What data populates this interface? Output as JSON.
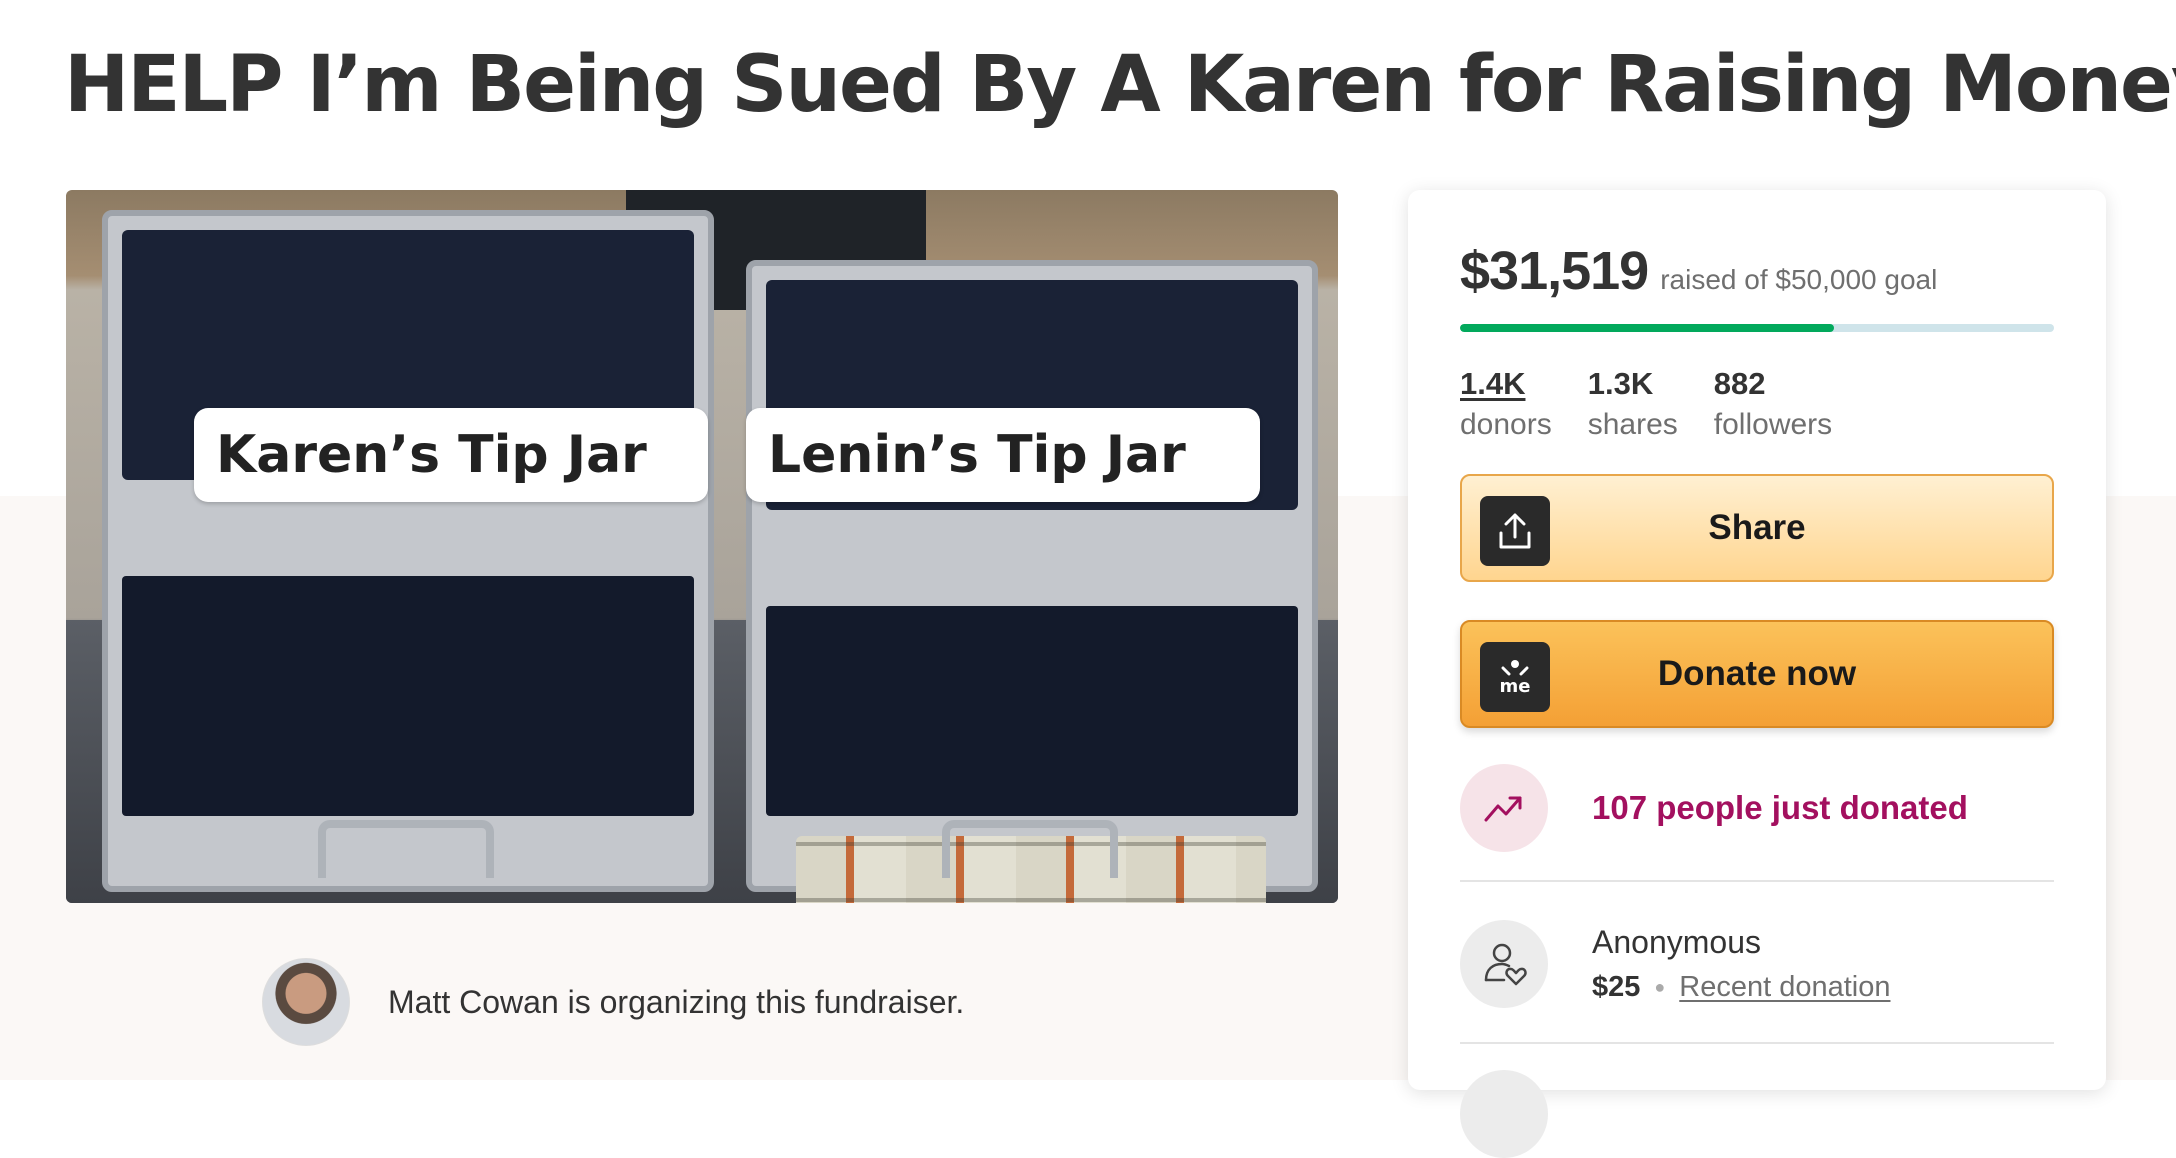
{
  "page": {
    "title": "HELP I’m Being Sued By A Karen for Raising Money"
  },
  "hero": {
    "left_label": "Karen’s Tip Jar",
    "right_label": "Lenin’s Tip Jar"
  },
  "organizer": {
    "text": "Matt Cowan is organizing this fundraiser."
  },
  "sidebar": {
    "raised_amount": "$31,519",
    "goal_text": "raised of $50,000 goal",
    "progress_fraction": 0.63,
    "stats": [
      {
        "value": "1.4K",
        "label": "donors"
      },
      {
        "value": "1.3K",
        "label": "shares"
      },
      {
        "value": "882",
        "label": "followers"
      }
    ],
    "share_label": "Share",
    "donate_label": "Donate now",
    "donate_icon_text": "me",
    "activity_text": "107 people just donated",
    "donation": {
      "name": "Anonymous",
      "amount": "$25",
      "tag": "Recent donation"
    }
  },
  "colors": {
    "progress": "#02a95c",
    "activity_text": "#a3105f",
    "donate_button": "#f4a035",
    "share_button": "#ffd58f"
  }
}
